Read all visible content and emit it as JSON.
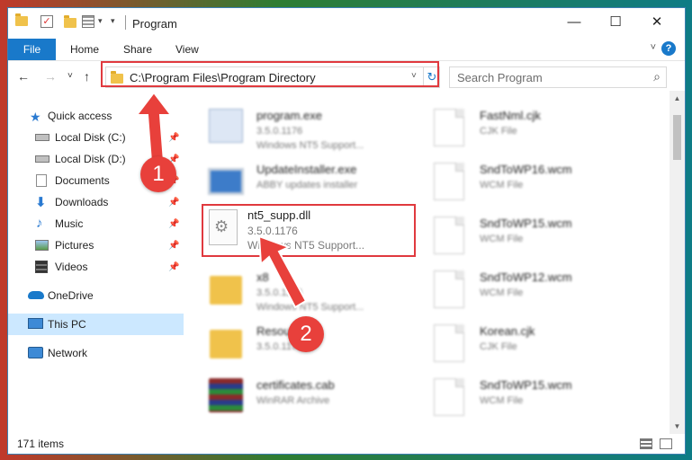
{
  "window": {
    "title": "Program",
    "minimize_glyph": "—",
    "maximize_glyph": "☐",
    "close_glyph": "✕"
  },
  "ribbon": {
    "tabs": [
      "File",
      "Home",
      "Share",
      "View"
    ],
    "help": "?"
  },
  "navigation": {
    "back_glyph": "←",
    "forward_glyph": "→",
    "up_glyph": "↑",
    "recent_glyph": "˅",
    "address": "C:\\Program Files\\Program Directory",
    "search_placeholder": "Search Program"
  },
  "sidebar": {
    "items": [
      {
        "label": "Quick access",
        "icon": "star-icon",
        "pinned": false
      },
      {
        "label": "Local Disk (C:)",
        "icon": "drive-icon",
        "pinned": true
      },
      {
        "label": "Local Disk (D:)",
        "icon": "drive-icon",
        "pinned": true
      },
      {
        "label": "Documents",
        "icon": "documents-icon",
        "pinned": true
      },
      {
        "label": "Downloads",
        "icon": "download-icon",
        "pinned": true
      },
      {
        "label": "Music",
        "icon": "music-icon",
        "pinned": true
      },
      {
        "label": "Pictures",
        "icon": "pictures-icon",
        "pinned": true
      },
      {
        "label": "Videos",
        "icon": "videos-icon",
        "pinned": true
      },
      {
        "label": "OneDrive",
        "icon": "cloud-icon",
        "pinned": false
      },
      {
        "label": "This PC",
        "icon": "computer-icon",
        "pinned": false,
        "selected": true
      },
      {
        "label": "Network",
        "icon": "network-icon",
        "pinned": false
      }
    ]
  },
  "files_left": [
    {
      "name": "program.exe",
      "line2": "3.5.0.1176",
      "line3": "Windows NT5 Support...",
      "icon": "exe-icon"
    },
    {
      "name": "UpdateInstaller.exe",
      "line2": "ABBY updates installer",
      "line3": "",
      "icon": "installer-icon"
    },
    {
      "name": "",
      "line2": "",
      "line3": "",
      "icon": "dll-icon"
    },
    {
      "name": "x8",
      "line2": "3.5.0.1176",
      "line3": "Windows NT5 Support...",
      "icon": "folder-icon"
    },
    {
      "name": "Resources",
      "line2": "3.5.0.1176",
      "line3": "",
      "icon": "folder-icon"
    },
    {
      "name": "certificates.cab",
      "line2": "WinRAR Archive",
      "line3": "",
      "icon": "winrar-icon"
    }
  ],
  "files_right": [
    {
      "name": "FastNml.cjk",
      "line2": "CJK File"
    },
    {
      "name": "SndToWP16.wcm",
      "line2": "WCM File"
    },
    {
      "name": "SndToWP15.wcm",
      "line2": "WCM File"
    },
    {
      "name": "SndToWP12.wcm",
      "line2": "WCM File"
    },
    {
      "name": "Korean.cjk",
      "line2": "CJK File"
    },
    {
      "name": "SndToWP15.wcm",
      "line2": "WCM File"
    }
  ],
  "highlighted_file": {
    "name": "nt5_supp.dll",
    "version": "3.5.0.1176",
    "description": "Windows NT5 Support..."
  },
  "status": {
    "item_count": "171 items"
  },
  "annotations": {
    "step1": "1",
    "step2": "2",
    "color": "#e8403b"
  }
}
